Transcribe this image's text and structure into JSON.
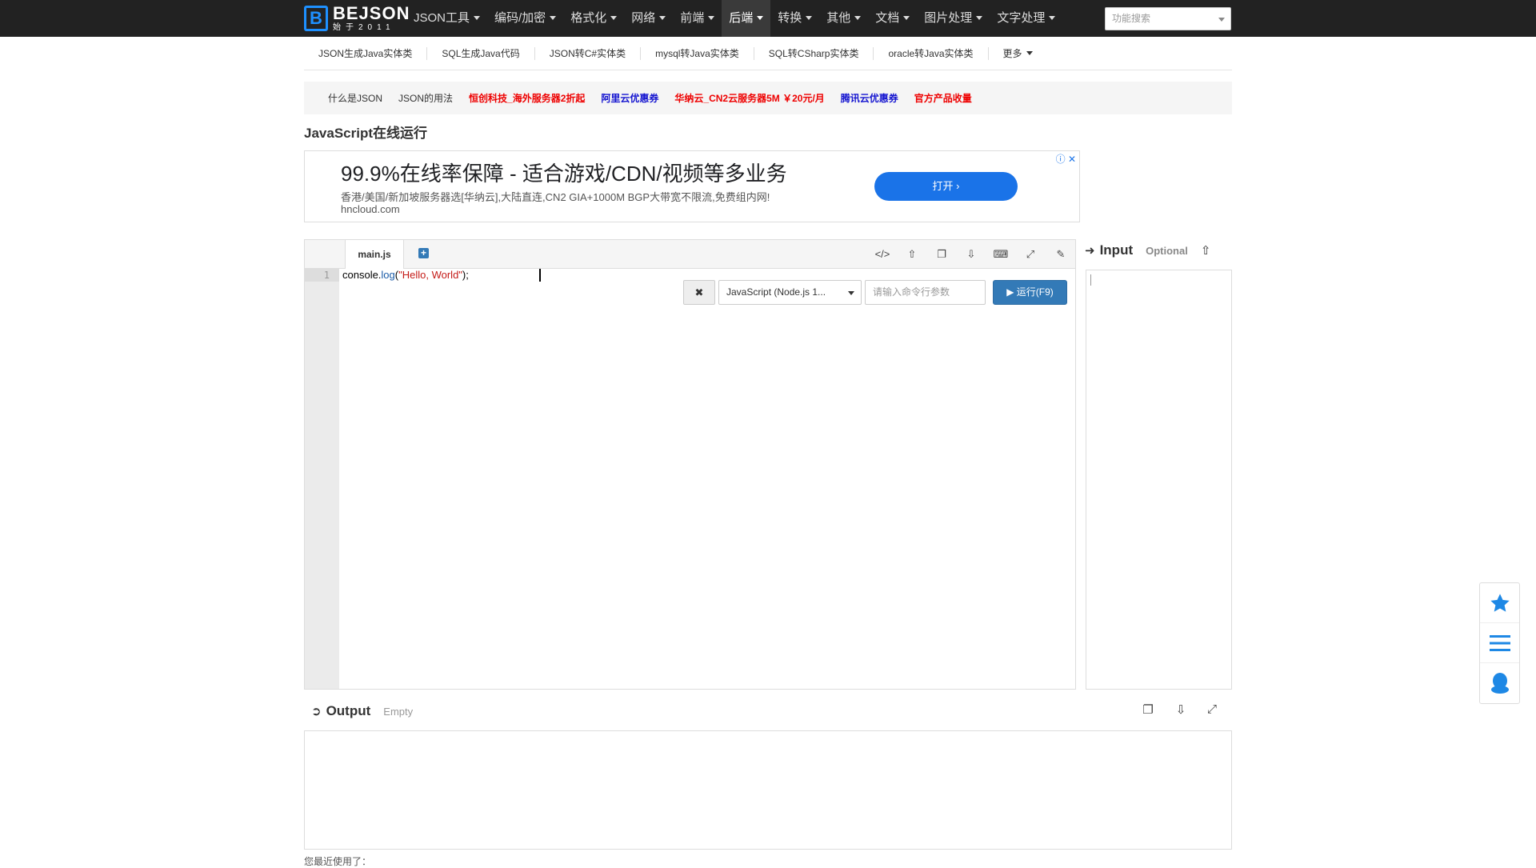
{
  "brand": {
    "name": "BEJSON",
    "sub": "始于2011"
  },
  "nav": {
    "items": [
      {
        "label": "JSON工具"
      },
      {
        "label": "编码/加密"
      },
      {
        "label": "格式化"
      },
      {
        "label": "网络"
      },
      {
        "label": "前端"
      },
      {
        "label": "后端"
      },
      {
        "label": "转换"
      },
      {
        "label": "其他"
      },
      {
        "label": "文档"
      },
      {
        "label": "图片处理"
      },
      {
        "label": "文字处理"
      }
    ],
    "active": "后端",
    "search_placeholder": "功能搜索"
  },
  "sublinks": [
    "JSON生成Java实体类",
    "SQL生成Java代码",
    "JSON转C#实体类",
    "mysql转Java实体类",
    "SQL转CSharp实体类",
    "oracle转Java实体类",
    "更多"
  ],
  "promo": [
    {
      "label": "什么是JSON",
      "style": "plain"
    },
    {
      "label": "JSON的用法",
      "style": "plain"
    },
    {
      "label": "恒创科技_海外服务器2折起",
      "style": "red"
    },
    {
      "label": "阿里云优惠券",
      "style": "blue"
    },
    {
      "label": "华纳云_CN2云服务器5M ￥20元/月",
      "style": "red"
    },
    {
      "label": "腾讯云优惠券",
      "style": "blue"
    },
    {
      "label": "官方产品收量",
      "style": "red"
    }
  ],
  "page_title": "JavaScript在线运行",
  "ad": {
    "headline": "99.9%在线率保障 - 适合游戏/CDN/视频等多业务",
    "desc": "香港/美国/新加坡服务器选[华纳云],大陆直连,CN2 GIA+1000M BGP大带宽不限流,免费组内网!",
    "url": "hncloud.com",
    "button": "打开"
  },
  "editor": {
    "tab": "main.js",
    "line_number": "1",
    "code": {
      "obj": "console.",
      "fn": "log",
      "open": "(",
      "str": "\"Hello, World\"",
      "close": ");"
    },
    "language": "JavaScript (Node.js 1...",
    "args_placeholder": "请输入命令行参数",
    "run_label": "运行(F9)"
  },
  "input": {
    "title": "Input",
    "state": "Optional"
  },
  "output": {
    "title": "Output",
    "state": "Empty"
  },
  "recent": "您最近使用了：",
  "colors": {
    "topbar": "#222222",
    "accent": "#337ab7",
    "ad_button": "#1a73e8",
    "float_icon": "#1e88e5"
  }
}
